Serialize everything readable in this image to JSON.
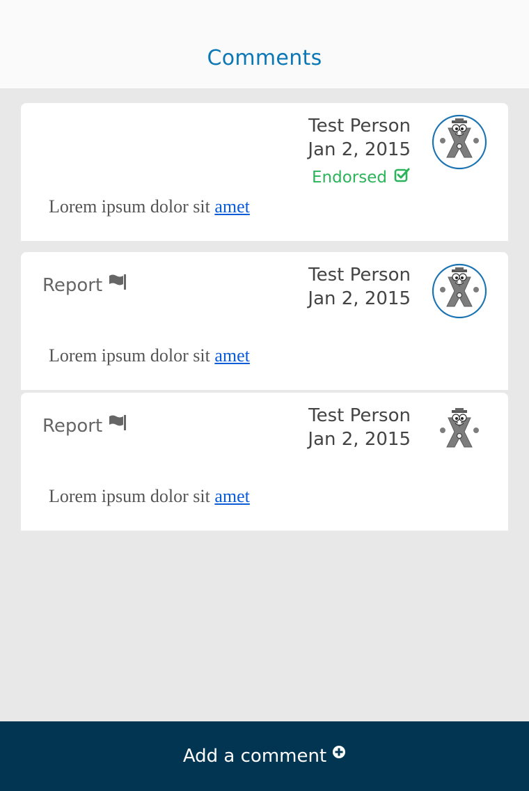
{
  "header": {
    "title": "Comments"
  },
  "comments": [
    {
      "author": "Test Person",
      "date": "Jan 2, 2015",
      "endorsed_label": "Endorsed",
      "body_text": "Lorem ipsum dolor sit ",
      "body_link": "amet",
      "avatar_icon": "avatar-mascot-icon",
      "avatar_ring": true
    },
    {
      "report_label": "Report",
      "author": "Test Person",
      "date": "Jan 2, 2015",
      "body_text": "Lorem ipsum dolor sit ",
      "body_link": "amet",
      "avatar_icon": "avatar-mascot-icon",
      "avatar_ring": true
    },
    {
      "report_label": "Report",
      "author": "Test Person",
      "date": "Jan 2, 2015",
      "body_text": "Lorem ipsum dolor sit ",
      "body_link": "amet",
      "avatar_icon": "avatar-mascot-icon",
      "avatar_ring": false
    }
  ],
  "footer": {
    "add_comment_label": "Add a comment",
    "icon": "plus-circle-icon"
  },
  "colors": {
    "accent": "#0b77b5",
    "endorsed": "#2bb35a",
    "footer_bg": "#023552",
    "link": "#0a5bd8"
  }
}
